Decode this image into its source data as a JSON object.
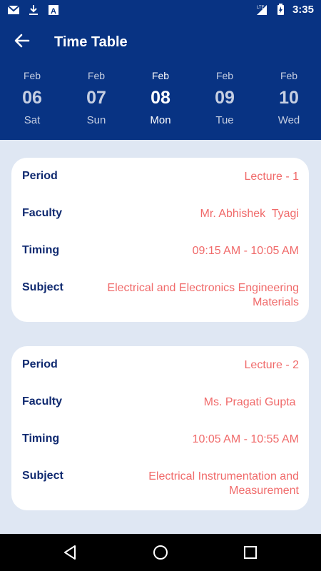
{
  "status_bar": {
    "time": "3:35",
    "network": "LTE",
    "left_icons": [
      "gmail-icon",
      "download-icon",
      "app-a-icon"
    ],
    "right_icons": [
      "signal-icon",
      "battery-icon"
    ]
  },
  "header": {
    "title": "Time Table",
    "back_icon": "arrow-left-icon",
    "background_color": "#083383"
  },
  "dates": [
    {
      "month": "Feb",
      "day": "06",
      "weekday": "Sat",
      "selected": false
    },
    {
      "month": "Feb",
      "day": "07",
      "weekday": "Sun",
      "selected": false
    },
    {
      "month": "Feb",
      "day": "08",
      "weekday": "Mon",
      "selected": true
    },
    {
      "month": "Feb",
      "day": "09",
      "weekday": "Tue",
      "selected": false
    },
    {
      "month": "Feb",
      "day": "10",
      "weekday": "Wed",
      "selected": false
    }
  ],
  "labels": {
    "period": "Period",
    "faculty": "Faculty",
    "timing": "Timing",
    "subject": "Subject"
  },
  "lectures": [
    {
      "period": "Lecture - 1",
      "faculty": "Mr. Abhishek  Tyagi",
      "timing": "09:15 AM - 10:05 AM",
      "subject": "Electrical and Electronics Engineering Materials"
    },
    {
      "period": "Lecture - 2",
      "faculty": "Ms. Pragati Gupta ",
      "timing": "10:05 AM - 10:55 AM",
      "subject": "Electrical Instrumentation and Measurement"
    }
  ],
  "colors": {
    "label": "#102a70",
    "value": "#f06a6a",
    "background": "#dfe7f3"
  },
  "nav_bar": {
    "icons": [
      "back-triangle-icon",
      "home-circle-icon",
      "recents-square-icon"
    ]
  }
}
